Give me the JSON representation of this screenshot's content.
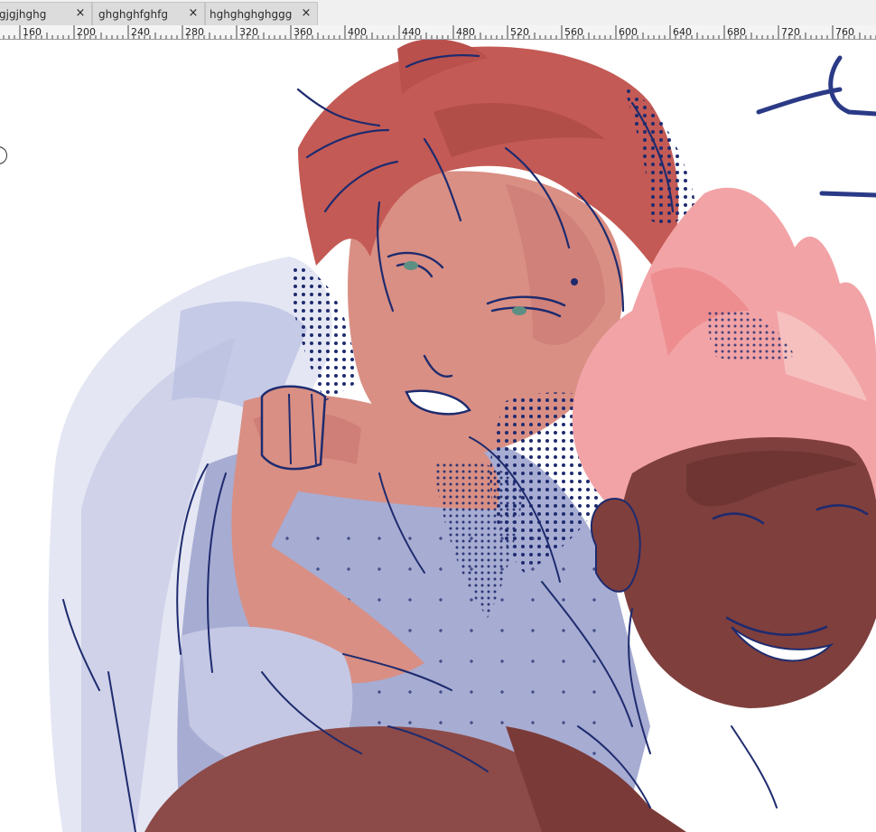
{
  "tabs": [
    {
      "label": "gjgjhghg",
      "close": "×"
    },
    {
      "label": "ghghghfghfg",
      "close": "×"
    },
    {
      "label": "hghghghghggg",
      "close": "×"
    }
  ],
  "ruler": {
    "labels": [
      "160",
      "200",
      "240",
      "280",
      "320",
      "360",
      "400",
      "440",
      "480",
      "520",
      "560",
      "600",
      "640",
      "680",
      "720",
      "760"
    ]
  },
  "canvas": {
    "artwork": "illustration",
    "colors": {
      "line": "#1e2b6e",
      "red_hair": "#c45a55",
      "skin_light": "#d98f84",
      "pink_hair": "#f2a3a6",
      "skin_dark": "#7f3f3d",
      "jacket": "#a7acd2"
    }
  }
}
